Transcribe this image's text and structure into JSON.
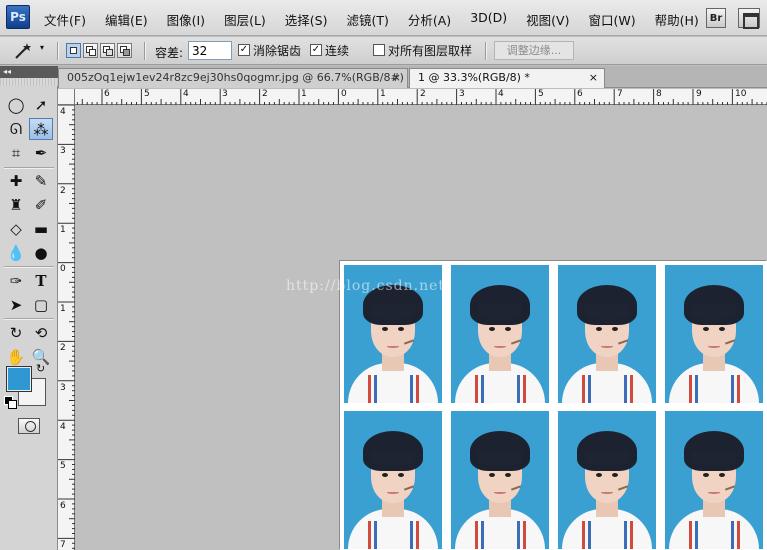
{
  "app": {
    "logo": "Ps"
  },
  "menu": [
    "文件(F)",
    "编辑(E)",
    "图像(I)",
    "图层(L)",
    "选择(S)",
    "滤镜(T)",
    "分析(A)",
    "3D(D)",
    "视图(V)",
    "窗口(W)",
    "帮助(H)"
  ],
  "right_icons": {
    "bridge": "Br"
  },
  "options": {
    "tool_icon": "magic-wand-icon",
    "tolerance_label": "容差:",
    "tolerance_value": "32",
    "antialias_label": "消除锯齿",
    "antialias_checked": "✓",
    "contiguous_label": "连续",
    "contiguous_checked": "✓",
    "sample_all_label": "对所有图层取样",
    "sample_all_checked": "",
    "refine_edge_label": "调整边缘..."
  },
  "tabs": [
    {
      "label": "005zOq1ejw1ev24r8zc9ej30hs0qogmr.jpg @ 66.7%(RGB/8#) *",
      "close": "×",
      "active": false
    },
    {
      "label": "1 @ 33.3%(RGB/8) *",
      "close": "×",
      "active": true
    }
  ],
  "tools_panel": {
    "collapse": "◂◂"
  },
  "ruler_top": [
    "6",
    "5",
    "4",
    "3",
    "2",
    "1",
    "0",
    "1",
    "2",
    "3",
    "4",
    "5",
    "6",
    "7",
    "8",
    "9",
    "10"
  ],
  "ruler_left": [
    "4",
    "3",
    "2",
    "1",
    "0",
    "1",
    "2",
    "3",
    "4",
    "5",
    "6",
    "7"
  ],
  "colors": {
    "foreground": "#2f97d1",
    "background": "#f4f4f4",
    "photo_bg": "#3aa0d2"
  },
  "canvas": {
    "watermark": "http://blog.csdn.net/",
    "photo_rows": 2,
    "photo_cols": 4
  }
}
